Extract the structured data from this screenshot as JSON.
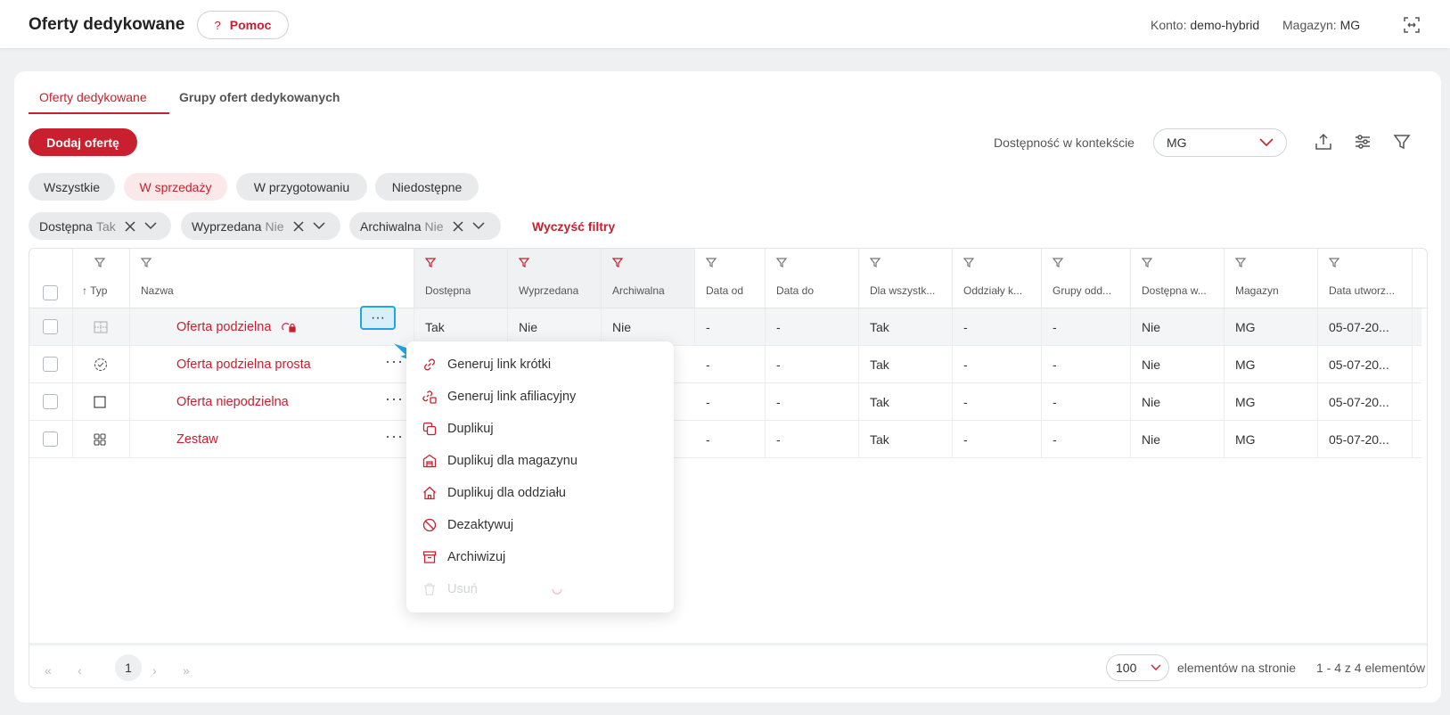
{
  "header": {
    "title": "Oferty dedykowane",
    "help_label": "Pomoc",
    "help_icon": "?",
    "account_label": "Konto:",
    "account_value": "demo-hybrid",
    "warehouse_label": "Magazyn:",
    "warehouse_value": "MG"
  },
  "tabs": [
    {
      "label": "Oferty dedykowane",
      "active": true
    },
    {
      "label": "Grupy ofert dedykowanych",
      "active": false
    }
  ],
  "toolbar": {
    "add_label": "Dodaj ofertę",
    "context_label": "Dostępność w kontekście",
    "context_value": "MG"
  },
  "status_filters": [
    {
      "label": "Wszystkie",
      "active": false
    },
    {
      "label": "W sprzedaży",
      "active": true
    },
    {
      "label": "W przygotowaniu",
      "active": false
    },
    {
      "label": "Niedostępne",
      "active": false
    }
  ],
  "filter_chips": [
    {
      "label": "Dostępna",
      "value": "Tak"
    },
    {
      "label": "Wyprzedana",
      "value": "Nie"
    },
    {
      "label": "Archiwalna",
      "value": "Nie"
    }
  ],
  "clear_filters": "Wyczyść filtry",
  "table": {
    "columns": [
      "Typ",
      "Nazwa",
      "Dostępna",
      "Wyprzedana",
      "Archiwalna",
      "Data od",
      "Data do",
      "Dla wszystk...",
      "Oddziały k...",
      "Grupy odd...",
      "Dostępna w...",
      "Magazyn",
      "Data utworz..."
    ],
    "sort_icon": "↑",
    "rows": [
      {
        "name": "Oferta podzielna",
        "available": "Tak",
        "sold_out": "Nie",
        "archived": "Nie",
        "date_from": "-",
        "date_to": "-",
        "for_all": "Tak",
        "branches": "-",
        "branch_groups": "-",
        "available_in": "Nie",
        "warehouse": "MG",
        "created": "05-07-20..."
      },
      {
        "name": "Oferta podzielna prosta",
        "available": "",
        "sold_out": "",
        "archived": "",
        "date_from": "-",
        "date_to": "-",
        "for_all": "Tak",
        "branches": "-",
        "branch_groups": "-",
        "available_in": "Nie",
        "warehouse": "MG",
        "created": "05-07-20..."
      },
      {
        "name": "Oferta niepodzielna",
        "available": "",
        "sold_out": "",
        "archived": "",
        "date_from": "-",
        "date_to": "-",
        "for_all": "Tak",
        "branches": "-",
        "branch_groups": "-",
        "available_in": "Nie",
        "warehouse": "MG",
        "created": "05-07-20..."
      },
      {
        "name": "Zestaw",
        "available": "",
        "sold_out": "",
        "archived": "",
        "date_from": "-",
        "date_to": "-",
        "for_all": "Tak",
        "branches": "-",
        "branch_groups": "-",
        "available_in": "Nie",
        "warehouse": "MG",
        "created": "05-07-20..."
      }
    ]
  },
  "context_menu": [
    {
      "label": "Generuj link krótki",
      "icon": "link-icon"
    },
    {
      "label": "Generuj link afiliacyjny",
      "icon": "affiliate-link-icon"
    },
    {
      "label": "Duplikuj",
      "icon": "duplicate-icon"
    },
    {
      "label": "Duplikuj dla magazynu",
      "icon": "warehouse-icon"
    },
    {
      "label": "Duplikuj dla oddziału",
      "icon": "home-icon"
    },
    {
      "label": "Dezaktywuj",
      "icon": "ban-icon"
    },
    {
      "label": "Archiwizuj",
      "icon": "archive-icon"
    },
    {
      "label": "Usuń",
      "icon": "trash-icon",
      "disabled": true
    }
  ],
  "pagination": {
    "current_page": "1",
    "first": "«",
    "prev": "‹",
    "next": "›",
    "last": "»",
    "per_page": "100",
    "per_page_label": "elementów na stronie",
    "range_label": "1 - 4 z 4 elementów"
  },
  "colors": {
    "accent": "#c8202e",
    "highlight": "#1ea6e6"
  }
}
